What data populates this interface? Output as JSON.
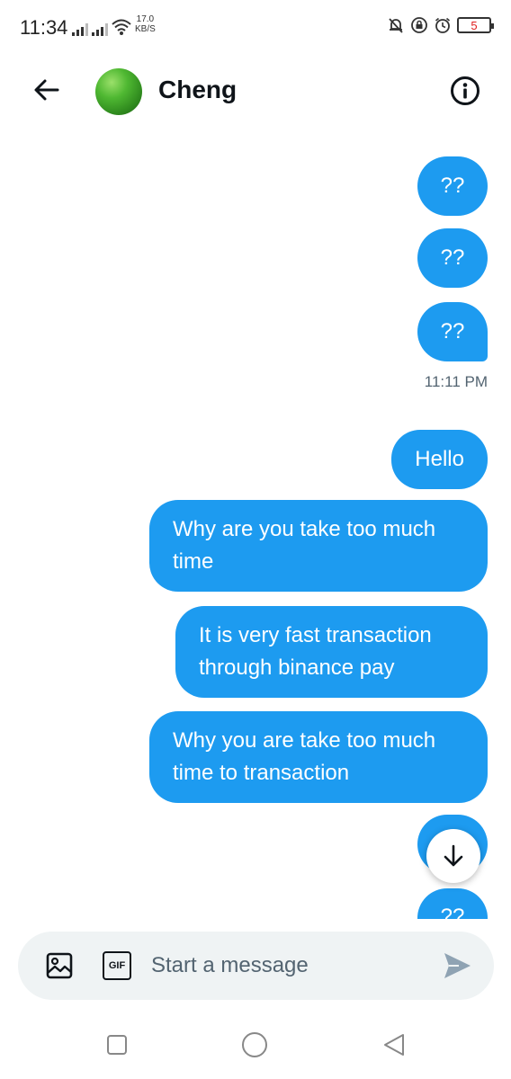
{
  "status_bar": {
    "time": "11:34",
    "net_speed_value": "17.0",
    "net_speed_unit": "KB/S",
    "battery": "5"
  },
  "header": {
    "contact_name": "Cheng",
    "back_icon": "arrow-left-icon",
    "info_icon": "info-circle-icon"
  },
  "messages": {
    "m1": "??",
    "m2": "??",
    "m3": "??",
    "timestamp": "11:11 PM",
    "m4": "Hello",
    "m5": "Why are you take too much time",
    "m6": "It is very fast transaction through binance pay",
    "m7": "Why you are take too much time to transaction",
    "m8": "??",
    "m9": "??"
  },
  "composer": {
    "placeholder": "Start a message",
    "gif_label": "GIF"
  },
  "colors": {
    "bubble": "#1d9bf0",
    "composer_bg": "#eff3f4",
    "muted_text": "#536471"
  }
}
